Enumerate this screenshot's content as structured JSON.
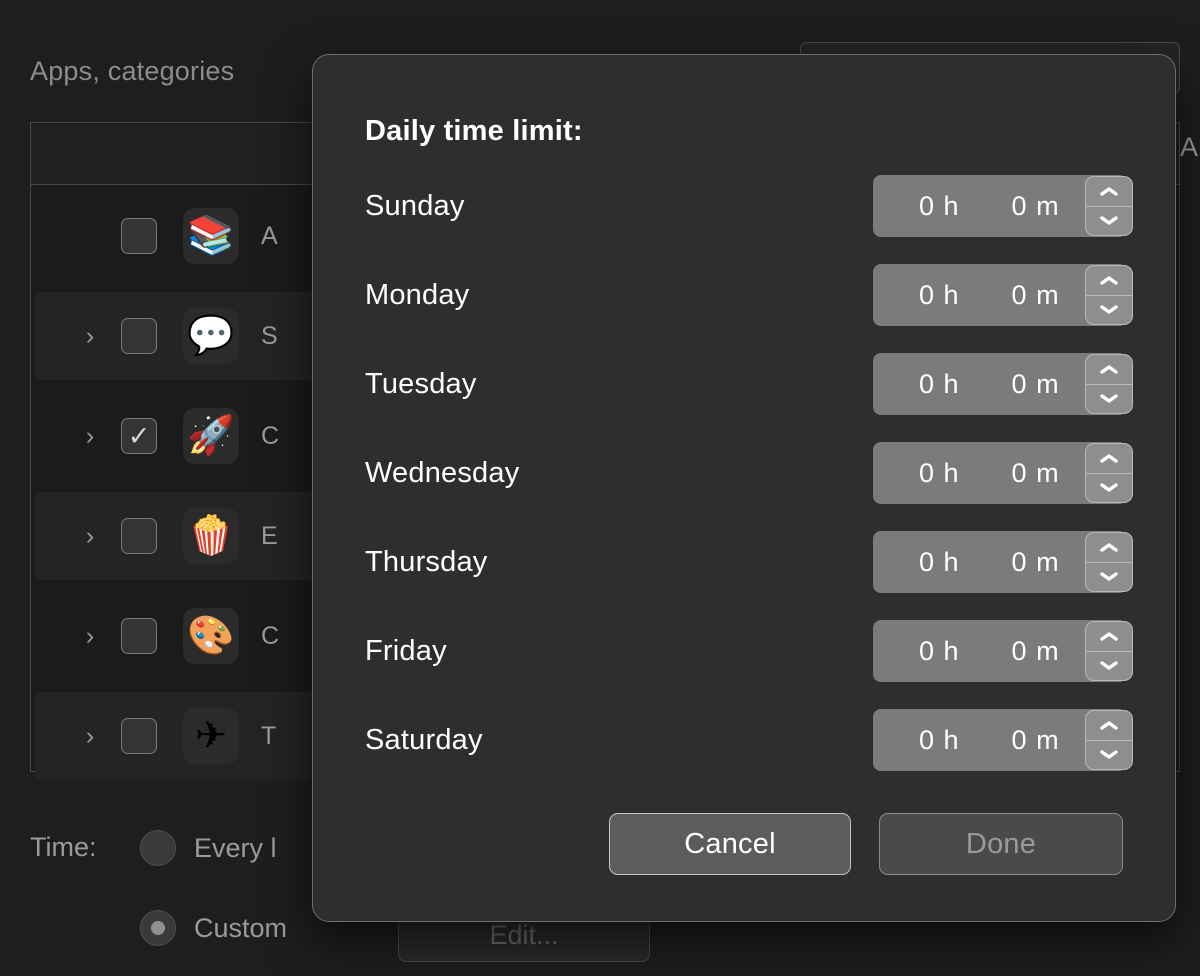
{
  "background": {
    "heading": "Apps, categories",
    "right_column_letter": "A",
    "rows": [
      {
        "icon": "books-stack-icon",
        "glyph": "📚",
        "label": "A",
        "checked": false,
        "disclosure": false,
        "alt": false
      },
      {
        "icon": "speech-bubble-heart-icon",
        "glyph": "💬",
        "label": "S",
        "checked": false,
        "disclosure": true,
        "alt": true
      },
      {
        "icon": "rocket-icon",
        "glyph": "🚀",
        "label": "C",
        "checked": true,
        "disclosure": true,
        "alt": false
      },
      {
        "icon": "popcorn-icon",
        "glyph": "🍿",
        "label": "E",
        "checked": false,
        "disclosure": true,
        "alt": true
      },
      {
        "icon": "artist-palette-icon",
        "glyph": "🎨",
        "label": "C",
        "checked": false,
        "disclosure": true,
        "alt": false
      },
      {
        "icon": "paper-plane-icon",
        "glyph": "✈",
        "label": "T",
        "checked": false,
        "disclosure": true,
        "alt": true
      }
    ],
    "time_label": "Time:",
    "radio_every_day": {
      "label": "Every l",
      "selected": false
    },
    "radio_custom": {
      "label": "Custom",
      "selected": true
    },
    "edit_button": "Edit..."
  },
  "modal": {
    "title": "Daily time limit:",
    "days": [
      {
        "name": "Sunday",
        "hours": "0 h",
        "minutes": "0 m"
      },
      {
        "name": "Monday",
        "hours": "0 h",
        "minutes": "0 m"
      },
      {
        "name": "Tuesday",
        "hours": "0 h",
        "minutes": "0 m"
      },
      {
        "name": "Wednesday",
        "hours": "0 h",
        "minutes": "0 m"
      },
      {
        "name": "Thursday",
        "hours": "0 h",
        "minutes": "0 m"
      },
      {
        "name": "Friday",
        "hours": "0 h",
        "minutes": "0 m"
      },
      {
        "name": "Saturday",
        "hours": "0 h",
        "minutes": "0 m"
      }
    ],
    "cancel_label": "Cancel",
    "done_label": "Done",
    "done_disabled": true
  },
  "colors": {
    "page_background": "#1e1e1e",
    "modal_background": "#2e2e2e",
    "modal_border": "#6e6e6e",
    "field_background": "#7b7b7b",
    "stepper_background": "#8e8e8e",
    "text_primary": "#ffffff",
    "text_secondary": "#9b9b9b",
    "disabled_text": "#9a9a9a"
  }
}
